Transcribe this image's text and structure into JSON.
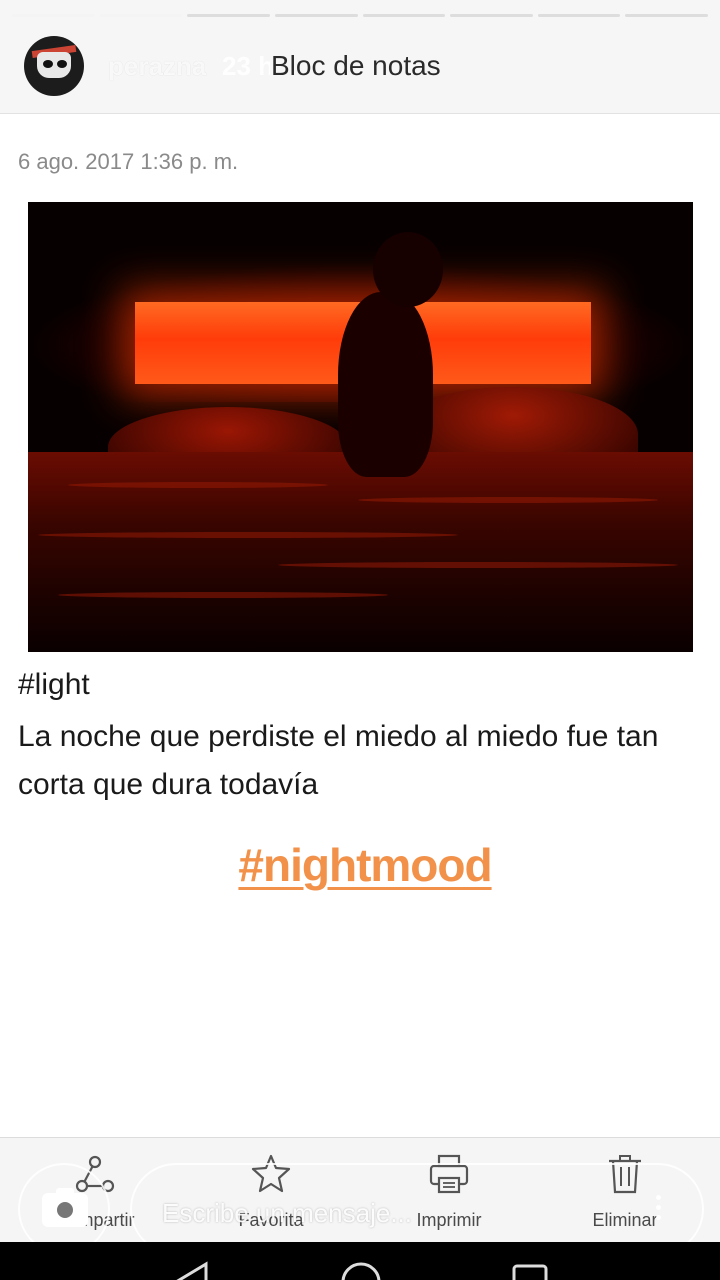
{
  "story": {
    "progress": [
      1,
      1,
      0,
      0,
      0,
      0,
      0,
      0
    ]
  },
  "header": {
    "username": "perazna",
    "time": "23 h",
    "app_title": "Bloc de notas"
  },
  "note": {
    "date": "6 ago. 2017 1:36 p. m.",
    "tag": "#light",
    "text": "La noche que perdiste el miedo al miedo fue tan corta que dura todavía",
    "hashtag": "#nightmood"
  },
  "toolbar": {
    "items": [
      {
        "label": "Compartir",
        "icon": "share-icon"
      },
      {
        "label": "Favorita",
        "icon": "star-icon"
      },
      {
        "label": "Imprimir",
        "icon": "print-icon"
      },
      {
        "label": "Eliminar",
        "icon": "trash-icon"
      }
    ]
  },
  "reply": {
    "placeholder": "Escribe un mensaje..."
  },
  "colors": {
    "hashtag": "#f2924a",
    "header_bg": "#f6f6f6",
    "toolbar_bg": "#f5f5f5"
  }
}
